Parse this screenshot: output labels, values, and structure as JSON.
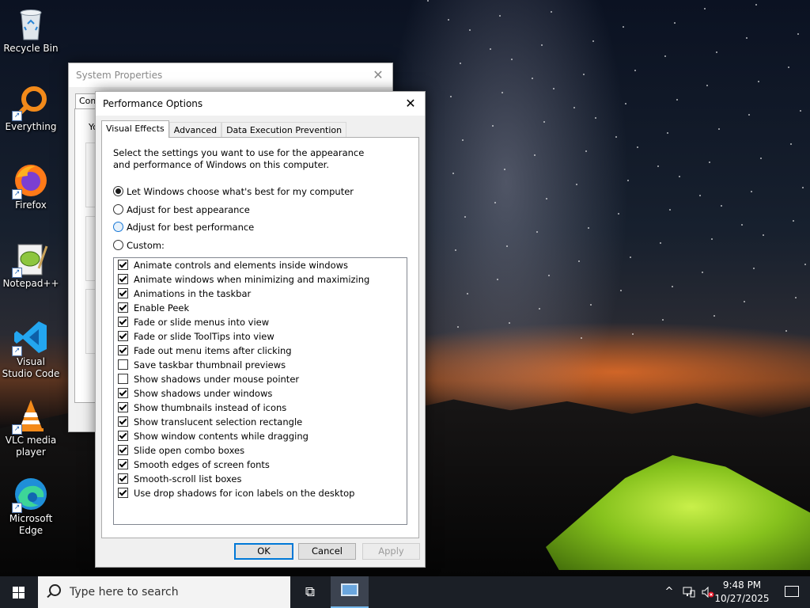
{
  "desktop": {
    "icons": [
      {
        "label": "Recycle Bin",
        "icon": "recycle-bin-icon"
      },
      {
        "label": "Everything",
        "icon": "everything-search-icon"
      },
      {
        "label": "Firefox",
        "icon": "firefox-icon"
      },
      {
        "label": "Notepad++",
        "icon": "notepadpp-icon"
      },
      {
        "label": "Visual Studio Code",
        "icon": "vscode-icon"
      },
      {
        "label": "VLC media player",
        "icon": "vlc-icon"
      },
      {
        "label": "Microsoft Edge",
        "icon": "edge-icon"
      }
    ]
  },
  "system_properties": {
    "title": "System Properties",
    "close_glyph": "✕",
    "tab_partial": "Com",
    "text_partial": "Yo"
  },
  "performance_options": {
    "title": "Performance Options",
    "close_glyph": "✕",
    "tabs": [
      {
        "label": "Visual Effects",
        "active": true
      },
      {
        "label": "Advanced",
        "active": false
      },
      {
        "label": "Data Execution Prevention",
        "active": false
      }
    ],
    "intro": "Select the settings you want to use for the appearance and performance of Windows on this computer.",
    "radios": [
      {
        "label": "Let Windows choose what's best for my computer",
        "checked": true
      },
      {
        "label": "Adjust for best appearance",
        "checked": false
      },
      {
        "label": "Adjust for best performance",
        "checked": false
      },
      {
        "label": "Custom:",
        "checked": false
      }
    ],
    "effects": [
      {
        "label": "Animate controls and elements inside windows",
        "checked": true
      },
      {
        "label": "Animate windows when minimizing and maximizing",
        "checked": true
      },
      {
        "label": "Animations in the taskbar",
        "checked": true
      },
      {
        "label": "Enable Peek",
        "checked": true
      },
      {
        "label": "Fade or slide menus into view",
        "checked": true
      },
      {
        "label": "Fade or slide ToolTips into view",
        "checked": true
      },
      {
        "label": "Fade out menu items after clicking",
        "checked": true
      },
      {
        "label": "Save taskbar thumbnail previews",
        "checked": false
      },
      {
        "label": "Show shadows under mouse pointer",
        "checked": false
      },
      {
        "label": "Show shadows under windows",
        "checked": true
      },
      {
        "label": "Show thumbnails instead of icons",
        "checked": true
      },
      {
        "label": "Show translucent selection rectangle",
        "checked": true
      },
      {
        "label": "Show window contents while dragging",
        "checked": true
      },
      {
        "label": "Slide open combo boxes",
        "checked": true
      },
      {
        "label": "Smooth edges of screen fonts",
        "checked": true
      },
      {
        "label": "Smooth-scroll list boxes",
        "checked": true
      },
      {
        "label": "Use drop shadows for icon labels on the desktop",
        "checked": true
      }
    ],
    "buttons": {
      "ok": "OK",
      "cancel": "Cancel",
      "apply": "Apply"
    }
  },
  "taskbar": {
    "search_placeholder": "Type here to search",
    "time": "9:48 PM",
    "date": "10/27/2025",
    "tray_chevron": "^"
  }
}
